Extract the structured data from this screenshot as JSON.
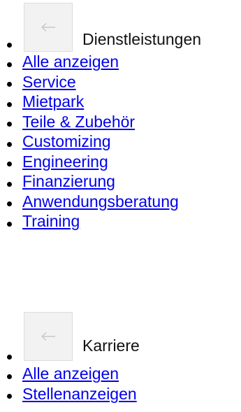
{
  "sections": [
    {
      "title": "Dienstleistungen",
      "back_icon": "arrow-left-icon",
      "links": [
        "Alle anzeigen",
        "Service",
        "Mietpark",
        "Teile & Zubehör",
        "Customizing",
        "Engineering",
        "Finanzierung",
        "Anwendungsberatung",
        "Training"
      ]
    },
    {
      "title": "Karriere",
      "back_icon": "arrow-left-icon",
      "links": [
        "Alle anzeigen",
        "Stellenanzeigen"
      ]
    }
  ],
  "colors": {
    "link": "#0000ee",
    "text": "#000000",
    "button_bg": "#f2f2f2",
    "arrow": "#c8c8c8"
  }
}
